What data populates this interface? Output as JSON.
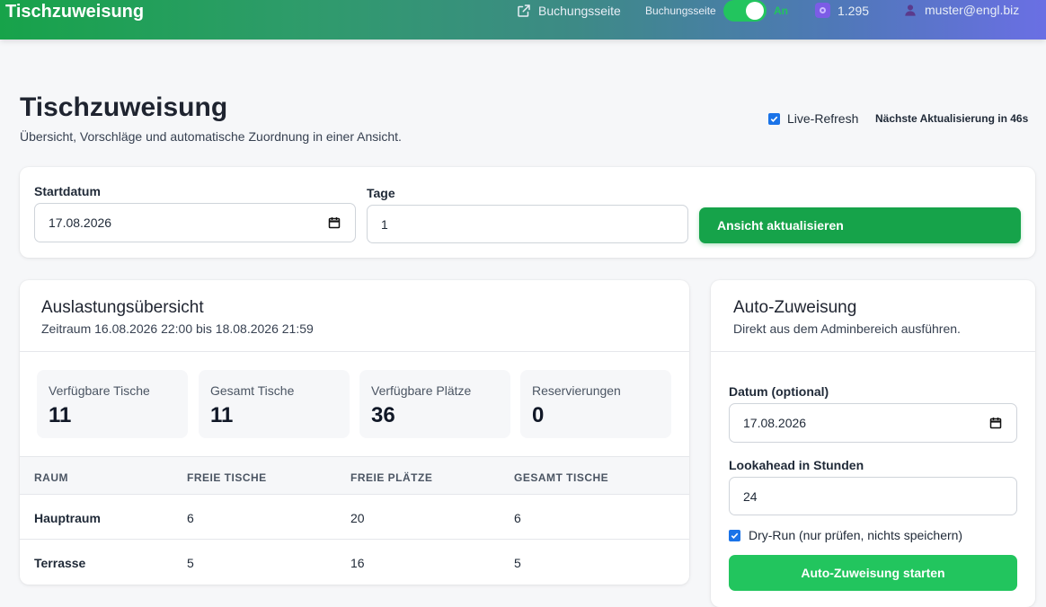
{
  "topbar": {
    "brand": "Tischzuweisung",
    "booking_link": "Buchungsseite",
    "toggle_label": "Buchungsseite",
    "toggle_state": "An",
    "toggle_on": true,
    "credits": "1.295",
    "user": "muster@engl.biz",
    "icons": [
      "external-link-icon",
      "coin-icon",
      "user-icon"
    ]
  },
  "header": {
    "title": "Tischzuweisung",
    "subtitle": "Übersicht, Vorschläge und automatische Zuordnung in einer Ansicht.",
    "live_refresh_label": "Live-Refresh",
    "live_refresh_checked": true,
    "next_refresh": "Nächste Aktualisierung in 46s"
  },
  "filter": {
    "start_label": "Startdatum",
    "start_value": "17.08.2026",
    "days_label": "Tage",
    "days_value": "1",
    "refresh_button": "Ansicht aktualisieren"
  },
  "utilization": {
    "title": "Auslastungsübersicht",
    "period": "Zeitraum 16.08.2026 22:00 bis 18.08.2026 21:59",
    "stats": [
      {
        "label": "Verfügbare Tische",
        "value": "11"
      },
      {
        "label": "Gesamt Tische",
        "value": "11"
      },
      {
        "label": "Verfügbare Plätze",
        "value": "36"
      },
      {
        "label": "Reservierungen",
        "value": "0"
      }
    ],
    "columns": [
      "RAUM",
      "FREIE TISCHE",
      "FREIE PLÄTZE",
      "GESAMT TISCHE"
    ],
    "rows": [
      [
        "Hauptraum",
        "6",
        "20",
        "6"
      ],
      [
        "Terrasse",
        "5",
        "16",
        "5"
      ]
    ]
  },
  "auto": {
    "title": "Auto-Zuweisung",
    "subtitle": "Direkt aus dem Adminbereich ausführen.",
    "date_label": "Datum (optional)",
    "date_value": "17.08.2026",
    "lookahead_label": "Lookahead in Stunden",
    "lookahead_value": "24",
    "dry_run_label": "Dry-Run (nur prüfen, nichts speichern)",
    "dry_run_checked": true,
    "start_button": "Auto-Zuweisung starten"
  },
  "colors": {
    "primary_green": "#16a34a",
    "accent_green": "#22c55e",
    "checkbox_blue": "#1a73e8"
  }
}
